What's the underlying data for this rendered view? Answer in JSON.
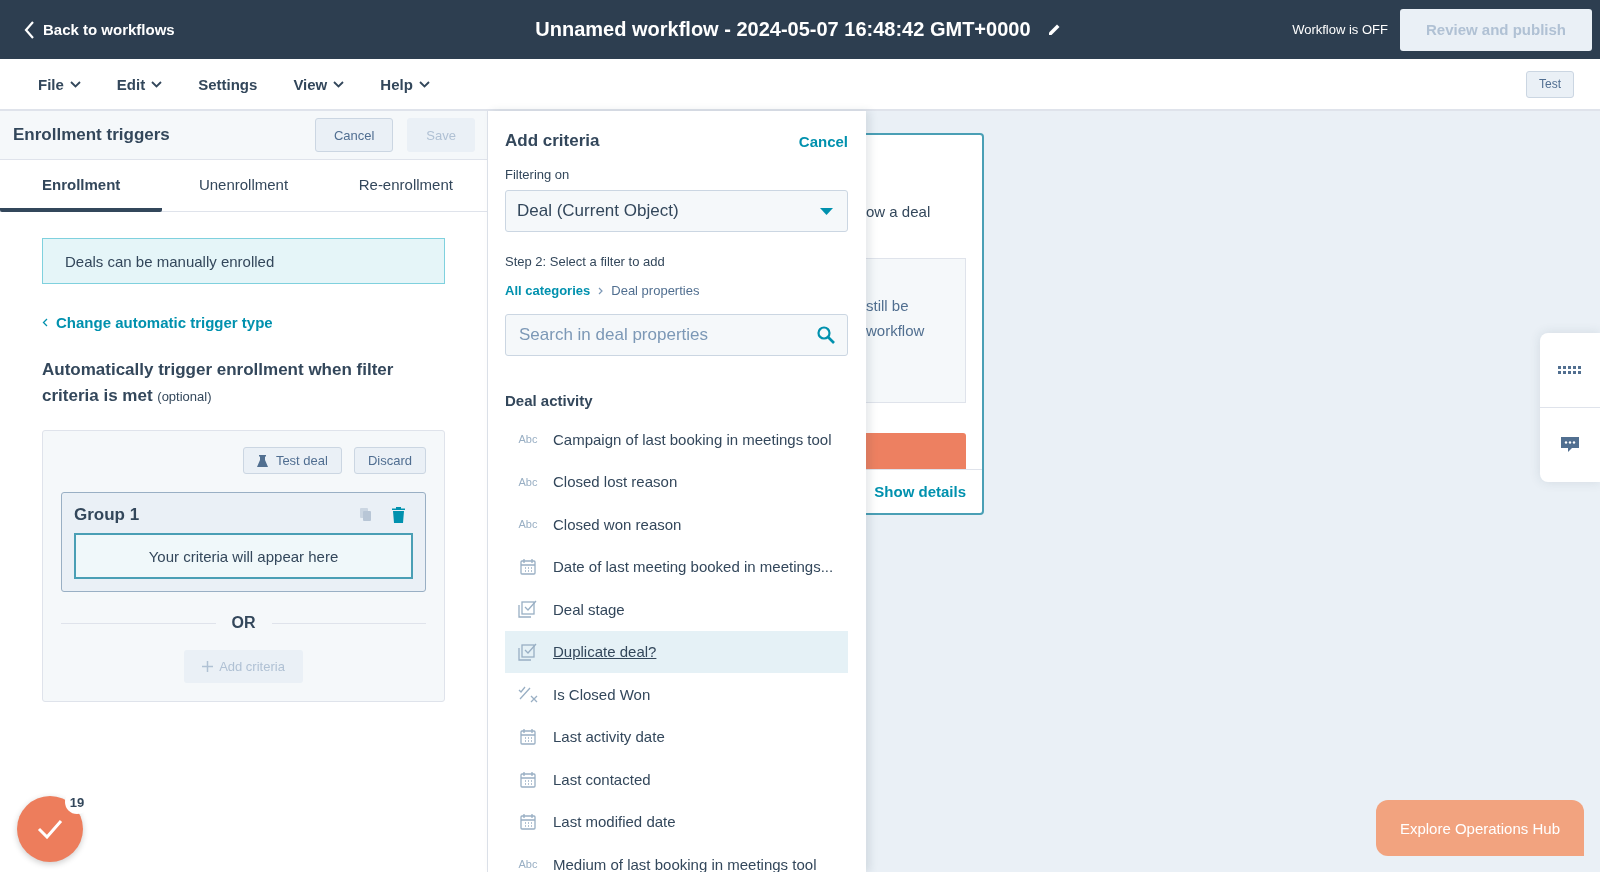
{
  "top_bar": {
    "back_link": "Back to workflows",
    "title": "Unnamed workflow - 2024-05-07 16:48:42 GMT+0000",
    "status": "Workflow is OFF",
    "publish_button": {
      "label": "Review and publish",
      "disabled": true
    }
  },
  "menu_bar": {
    "items": [
      {
        "label": "File",
        "dropdown": true
      },
      {
        "label": "Edit",
        "dropdown": true
      },
      {
        "label": "Settings",
        "dropdown": false
      },
      {
        "label": "View",
        "dropdown": true
      },
      {
        "label": "Help",
        "dropdown": true
      }
    ],
    "test_button": "Test"
  },
  "enrollment_panel": {
    "title": "Enrollment triggers",
    "buttons": [
      {
        "label": "Cancel",
        "disabled": false
      },
      {
        "label": "Save",
        "disabled": true
      }
    ],
    "tabs": [
      {
        "label": "Enrollment",
        "selected": true
      },
      {
        "label": "Unenrollment",
        "selected": false
      },
      {
        "label": "Re-enrollment",
        "selected": false
      }
    ],
    "notice": "Deals can be manually enrolled",
    "change_link": "Change automatic trigger type",
    "heading": "Automatically trigger enrollment when filter criteria is met",
    "heading_note": "(optional)",
    "filter_box": {
      "test_button": "Test deal",
      "discard_button": "Discard",
      "group": {
        "title": "Group 1",
        "placeholder": "Your criteria will appear here"
      },
      "separator": "OR",
      "add_button": {
        "label": "Add criteria",
        "disabled": true
      }
    }
  },
  "criteria_panel": {
    "title": "Add criteria",
    "cancel": "Cancel",
    "filter_label": "Filtering on",
    "object_select": "Deal (Current Object)",
    "step_label": "Step 2: Select a filter to add",
    "breadcrumbs": [
      {
        "label": "All categories",
        "link": true
      },
      {
        "label": "Deal properties",
        "link": false
      }
    ],
    "search": {
      "placeholder": "Search in deal properties"
    },
    "section": "Deal activity",
    "properties": [
      {
        "label": "Campaign of last booking in meetings tool",
        "kind": "text",
        "type_label": "Abc",
        "highlighted": false
      },
      {
        "label": "Closed lost reason",
        "kind": "text",
        "type_label": "Abc",
        "highlighted": false
      },
      {
        "label": "Closed won reason",
        "kind": "text",
        "type_label": "Abc",
        "highlighted": false
      },
      {
        "label": "Date of last meeting booked in meetings...",
        "kind": "date",
        "highlighted": false
      },
      {
        "label": "Deal stage",
        "kind": "enum",
        "highlighted": false
      },
      {
        "label": "Duplicate deal?",
        "kind": "enum",
        "highlighted": true
      },
      {
        "label": "Is Closed Won",
        "kind": "bool",
        "highlighted": false
      },
      {
        "label": "Last activity date",
        "kind": "date",
        "highlighted": false
      },
      {
        "label": "Last contacted",
        "kind": "date",
        "highlighted": false
      },
      {
        "label": "Last modified date",
        "kind": "date",
        "highlighted": false
      },
      {
        "label": "Medium of last booking in meetings tool",
        "kind": "text",
        "type_label": "Abc",
        "highlighted": false
      }
    ]
  },
  "canvas_card": {
    "text": "ow a deal",
    "note_lines": [
      "still be",
      "workflow"
    ],
    "link": "Show details"
  },
  "task_badge": {
    "count": "19"
  },
  "hub_button": "Explore Operations Hub"
}
